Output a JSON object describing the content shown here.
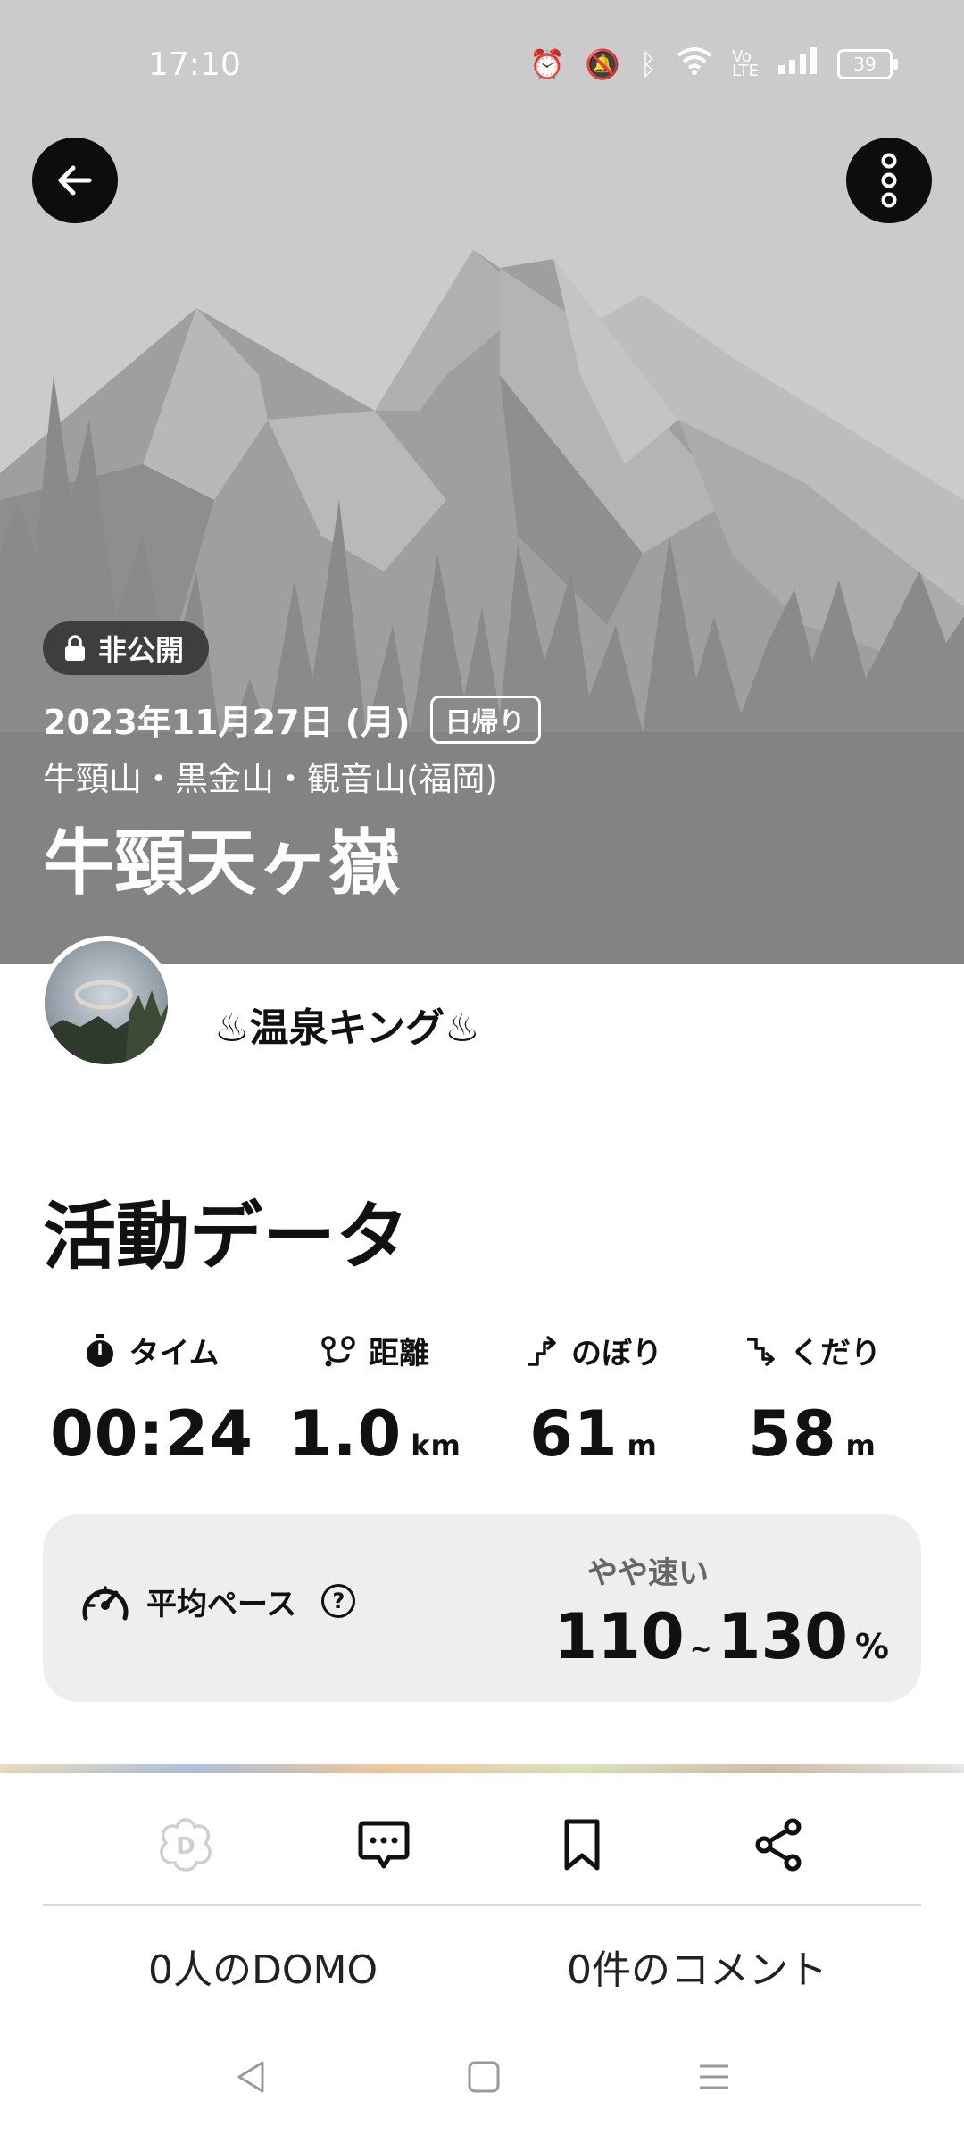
{
  "status_bar": {
    "time": "17:10",
    "battery": "39",
    "icons": [
      "alarm-icon",
      "mute-icon",
      "bluetooth-icon",
      "wifi-icon",
      "volte-icon",
      "signal-icon",
      "battery-icon"
    ]
  },
  "header": {
    "privacy_label": "非公開",
    "date": "2023年11月27日 (月)",
    "trip_type": "日帰り",
    "area": "牛頸山・黒金山・観音山(福岡)",
    "title": "牛頸天ヶ嶽"
  },
  "user": {
    "name": "♨温泉キング♨"
  },
  "activity": {
    "section_title": "活動データ",
    "stats": [
      {
        "label": "タイム",
        "value": "00:24",
        "unit": "",
        "icon": "stopwatch-icon"
      },
      {
        "label": "距離",
        "value": "1.0",
        "unit": "km",
        "icon": "route-icon"
      },
      {
        "label": "のぼり",
        "value": "61",
        "unit": "m",
        "icon": "ascent-icon"
      },
      {
        "label": "くだり",
        "value": "58",
        "unit": "m",
        "icon": "descent-icon"
      }
    ],
    "pace": {
      "label": "平均ペース",
      "help": "?",
      "speed_label": "やや速い",
      "range_min": "110",
      "range_sep": "~",
      "range_max": "130",
      "unit": "%"
    }
  },
  "bottom": {
    "domo_count": "0人のDOMO",
    "comment_count": "0件のコメント",
    "domo_icon_letter": "D"
  },
  "colors": {
    "hero_bg": "#cbcbcb",
    "pill_bg": "#3e3e3e",
    "card_bg": "#eeeeee"
  }
}
